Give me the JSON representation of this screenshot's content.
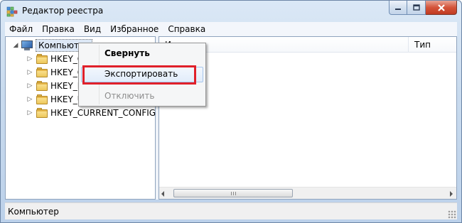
{
  "window": {
    "title": "Редактор реестра",
    "close_color": "#c8452b"
  },
  "menubar": {
    "items": [
      "Файл",
      "Правка",
      "Вид",
      "Избранное",
      "Справка"
    ]
  },
  "tree": {
    "root_label": "Компьютер",
    "root_icon": "computer-icon",
    "children": [
      "HKEY_C",
      "HKEY_C",
      "HKEY_L",
      "HKEY_U",
      "HKEY_CURRENT_CONFIG"
    ],
    "child_icon": "folder-icon"
  },
  "list": {
    "columns": [
      "Имя",
      "Тип"
    ]
  },
  "context_menu": {
    "items": [
      {
        "label": "Свернуть",
        "state": "default"
      },
      {
        "label": "Экспортировать",
        "state": "hover"
      },
      {
        "label": "Отключить",
        "state": "disabled"
      }
    ],
    "highlight_color": "#e0202a"
  },
  "statusbar": {
    "path": "Компьютер"
  }
}
